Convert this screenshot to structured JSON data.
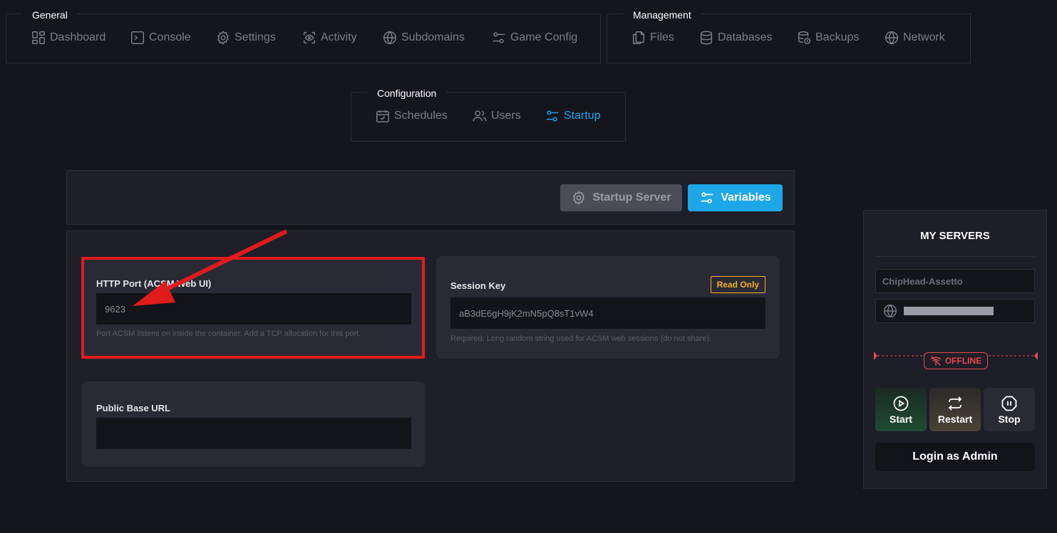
{
  "nav": {
    "general": {
      "title": "General",
      "items": [
        {
          "label": "Dashboard",
          "icon": "dashboard-icon"
        },
        {
          "label": "Console",
          "icon": "terminal-icon"
        },
        {
          "label": "Settings",
          "icon": "gear-icon"
        },
        {
          "label": "Activity",
          "icon": "eye-scan-icon"
        },
        {
          "label": "Subdomains",
          "icon": "globe-icon"
        },
        {
          "label": "Game Config",
          "icon": "sliders-icon"
        }
      ]
    },
    "management": {
      "title": "Management",
      "items": [
        {
          "label": "Files",
          "icon": "files-icon"
        },
        {
          "label": "Databases",
          "icon": "database-icon"
        },
        {
          "label": "Backups",
          "icon": "backup-icon"
        },
        {
          "label": "Network",
          "icon": "globe-icon"
        }
      ]
    },
    "configuration": {
      "title": "Configuration",
      "items": [
        {
          "label": "Schedules",
          "icon": "calendar-check-icon"
        },
        {
          "label": "Users",
          "icon": "users-icon"
        },
        {
          "label": "Startup",
          "icon": "sliders-icon",
          "active": true
        }
      ]
    }
  },
  "startup": {
    "startup_server_label": "Startup Server",
    "variables_label": "Variables"
  },
  "variables": [
    {
      "label": "HTTP Port (ACSM Web UI)",
      "value": "9623",
      "help": "Port ACSM listens on inside the container. Add a TCP allocation for this port."
    },
    {
      "label": "Session Key",
      "value": "aB3dE6gH9jK2mN5pQ8sT1vW4",
      "badge": "Read Only",
      "help": "Required. Long random string used for ACSM web sessions (do not share)."
    },
    {
      "label": "Public Base URL",
      "value": "",
      "help": ""
    }
  ],
  "sidebar": {
    "title": "MY SERVERS",
    "server_name": "ChipHead-Assetto",
    "status": "OFFLINE",
    "controls": {
      "start": "Start",
      "restart": "Restart",
      "stop": "Stop"
    },
    "admin_label": "Login as Admin"
  },
  "colors": {
    "accent": "#1ea7e8",
    "offline": "#e5484d",
    "read_only": "#f5b21b",
    "annotation": "#e01b1b"
  }
}
